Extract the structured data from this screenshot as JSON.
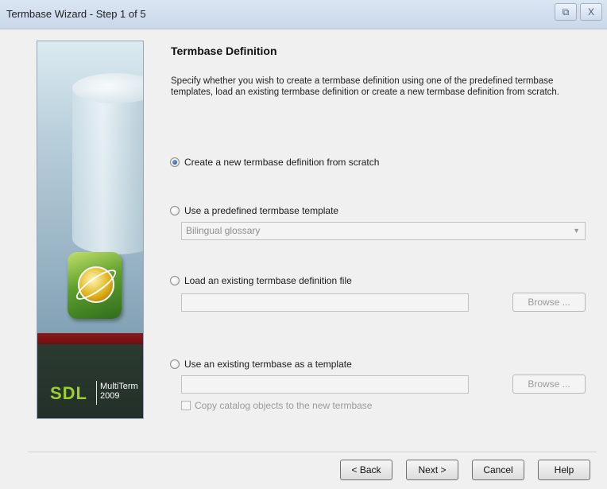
{
  "window": {
    "title": "Termbase Wizard - Step 1 of 5",
    "restore_glyph": "⧉",
    "close_glyph": "X"
  },
  "sidebar": {
    "brand": "SDL",
    "product_line1": "MultiTerm",
    "product_line2": "2009"
  },
  "page": {
    "heading": "Termbase Definition",
    "description": "Specify whether you wish to create a termbase definition using one of the predefined termbase templates, load an existing termbase definition or create a new termbase definition from scratch."
  },
  "options": {
    "new_from_scratch": {
      "label": "Create a new termbase definition from scratch",
      "checked": true
    },
    "predefined_template": {
      "label": "Use a predefined termbase template",
      "checked": false,
      "selected_value": "Bilingual glossary"
    },
    "load_existing_file": {
      "label": "Load an existing termbase definition file",
      "checked": false,
      "path_value": "",
      "browse_label": "Browse ..."
    },
    "existing_termbase": {
      "label": "Use an existing termbase as a template",
      "checked": false,
      "path_value": "",
      "browse_label": "Browse ...",
      "copy_catalog_label": "Copy catalog objects to the new termbase",
      "copy_catalog_checked": false
    }
  },
  "buttons": {
    "back": "< Back",
    "next": "Next >",
    "cancel": "Cancel",
    "help": "Help"
  }
}
